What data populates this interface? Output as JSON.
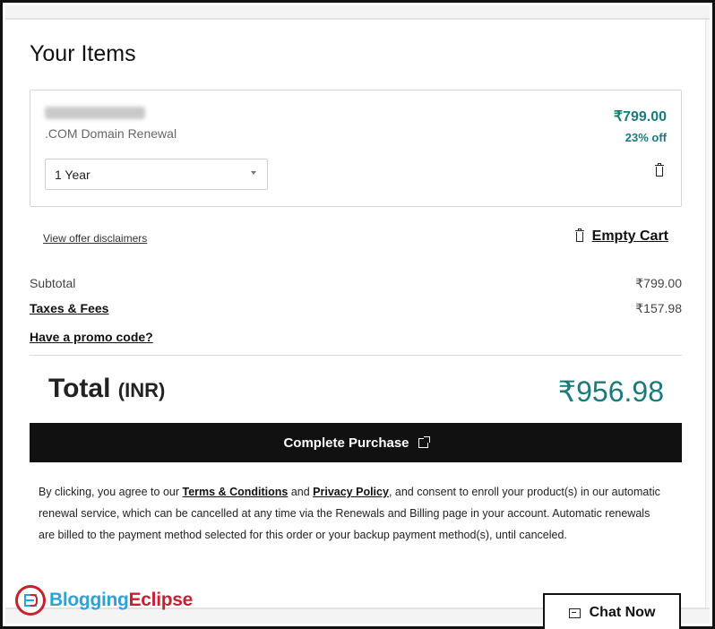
{
  "page": {
    "title": "Your Items"
  },
  "cart_item": {
    "domain_name": "xxxxxxxx.COM",
    "domain_name_blurred": true,
    "description": ".COM Domain Renewal",
    "term_selected": "1 Year",
    "price": "₹799.00",
    "discount": "23% off",
    "remove_icon": "trash-icon"
  },
  "links": {
    "disclaimers": "View offer disclaimers",
    "empty_cart": "Empty Cart",
    "promo": "Have a promo code?"
  },
  "summary": {
    "subtotal_label": "Subtotal",
    "subtotal_value": "₹799.00",
    "taxes_label": "Taxes & Fees",
    "taxes_value": "₹157.98"
  },
  "total": {
    "label": "Total",
    "currency": "(INR)",
    "value": "₹956.98"
  },
  "actions": {
    "complete_purchase": "Complete Purchase",
    "complete_purchase_icon": "external-link-icon"
  },
  "legal": {
    "part1": "By clicking, you agree to our ",
    "terms_link": "Terms & Conditions",
    "part2": " and ",
    "privacy_link": "Privacy Policy",
    "part3": ", and consent to enroll your product(s) in our automatic renewal service, which can be cancelled at any time via the Renewals and Billing page in your account. Automatic renewals are billed to the payment method selected for this order or your backup payment method(s), until canceled."
  },
  "watermark": {
    "part1": "Blogging",
    "part2": "Eclipse"
  },
  "chat": {
    "label": "Chat Now",
    "icon": "chat-icon"
  },
  "colors": {
    "accent_teal": "#1b7a7a",
    "button_black": "#111111",
    "brand_blue": "#2aa3d6",
    "brand_red": "#c8202f"
  }
}
